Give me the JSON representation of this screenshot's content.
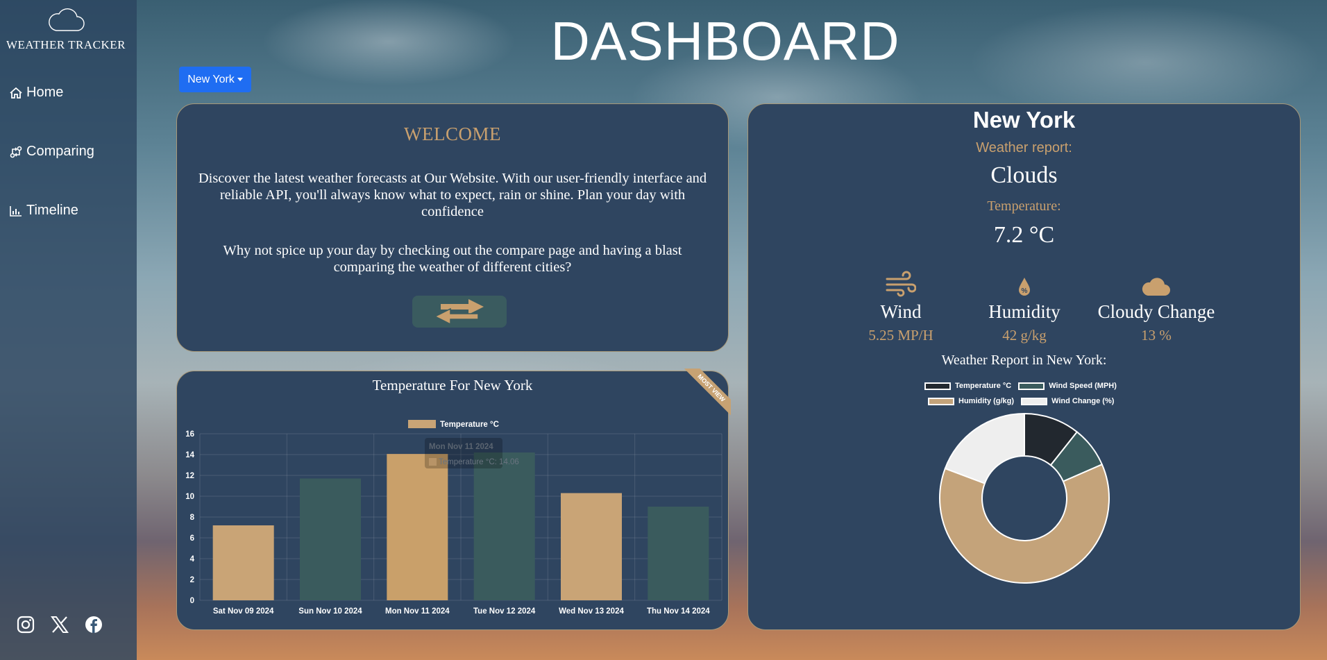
{
  "app": {
    "name": "WEATHER TRACKER",
    "page_title": "DASHBOARD"
  },
  "sidebar": {
    "items": [
      {
        "label": "Home",
        "icon": "home-icon"
      },
      {
        "label": "Comparing",
        "icon": "compare-icon"
      },
      {
        "label": "Timeline",
        "icon": "chart-icon"
      }
    ],
    "social": [
      "instagram-icon",
      "x-twitter-icon",
      "facebook-icon"
    ]
  },
  "city_select": {
    "selected": "New York"
  },
  "welcome": {
    "title": "WELCOME",
    "paragraph1": "Discover the latest weather forecasts at Our Website. With our user-friendly interface and reliable API, you'll always know what to expect, rain or shine. Plan your day with confidence",
    "paragraph2": "Why not spice up your day by checking out the compare page and having a blast comparing the weather of different cities?"
  },
  "temp_chart": {
    "title": "Temperature For New York",
    "ribbon": "MOST VIEW",
    "tooltip": {
      "title": "Mon Nov 11 2024",
      "body": "Temperature °C: 14.06"
    }
  },
  "report": {
    "city": "New York",
    "report_label": "Weather report:",
    "condition": "Clouds",
    "temperature_label": "Temperature:",
    "temperature": "7.2 °C",
    "stats": [
      {
        "label": "Wind",
        "value": "5.25 MP/H",
        "icon": "wind-icon"
      },
      {
        "label": "Humidity",
        "value": "42 g/kg",
        "icon": "humidity-icon"
      },
      {
        "label": "Cloudy Change",
        "value": "13 %",
        "icon": "cloud-icon"
      }
    ],
    "donut_title": "Weather Report in New York:"
  },
  "colors": {
    "accent": "#c9a06e",
    "card": "#2f4560",
    "teal": "#3a5b5d",
    "dark": "#22282f",
    "light": "#eeeeee",
    "button": "#1f6df2"
  },
  "chart_data": [
    {
      "type": "bar",
      "categories": [
        "Sat Nov 09 2024",
        "Sun Nov 10 2024",
        "Mon Nov 11 2024",
        "Tue Nov 12 2024",
        "Wed Nov 13 2024",
        "Thu Nov 14 2024"
      ],
      "series": [
        {
          "name": "Temperature °C",
          "values": [
            7.2,
            11.7,
            14.06,
            14.2,
            10.3,
            9.0
          ]
        }
      ],
      "bar_colors": [
        "#c9a476",
        "#3a5b5d",
        "#c9a06a",
        "#3a5b5d",
        "#c9a476",
        "#3a5b5d"
      ],
      "ylim": [
        0,
        16
      ],
      "yticks": [
        0,
        2,
        4,
        6,
        8,
        10,
        12,
        14,
        16
      ],
      "grid": true,
      "legend": "top"
    },
    {
      "type": "pie",
      "labels": [
        "Temperature °C",
        "Wind Speed (MPH)",
        "Humidity (g/kg)",
        "Wind Change (%)"
      ],
      "values": [
        7.2,
        5.25,
        42,
        13
      ],
      "colors": [
        "#22282f",
        "#3a5b5d",
        "#c4a37a",
        "#eeeeee"
      ],
      "legend": "top"
    }
  ]
}
